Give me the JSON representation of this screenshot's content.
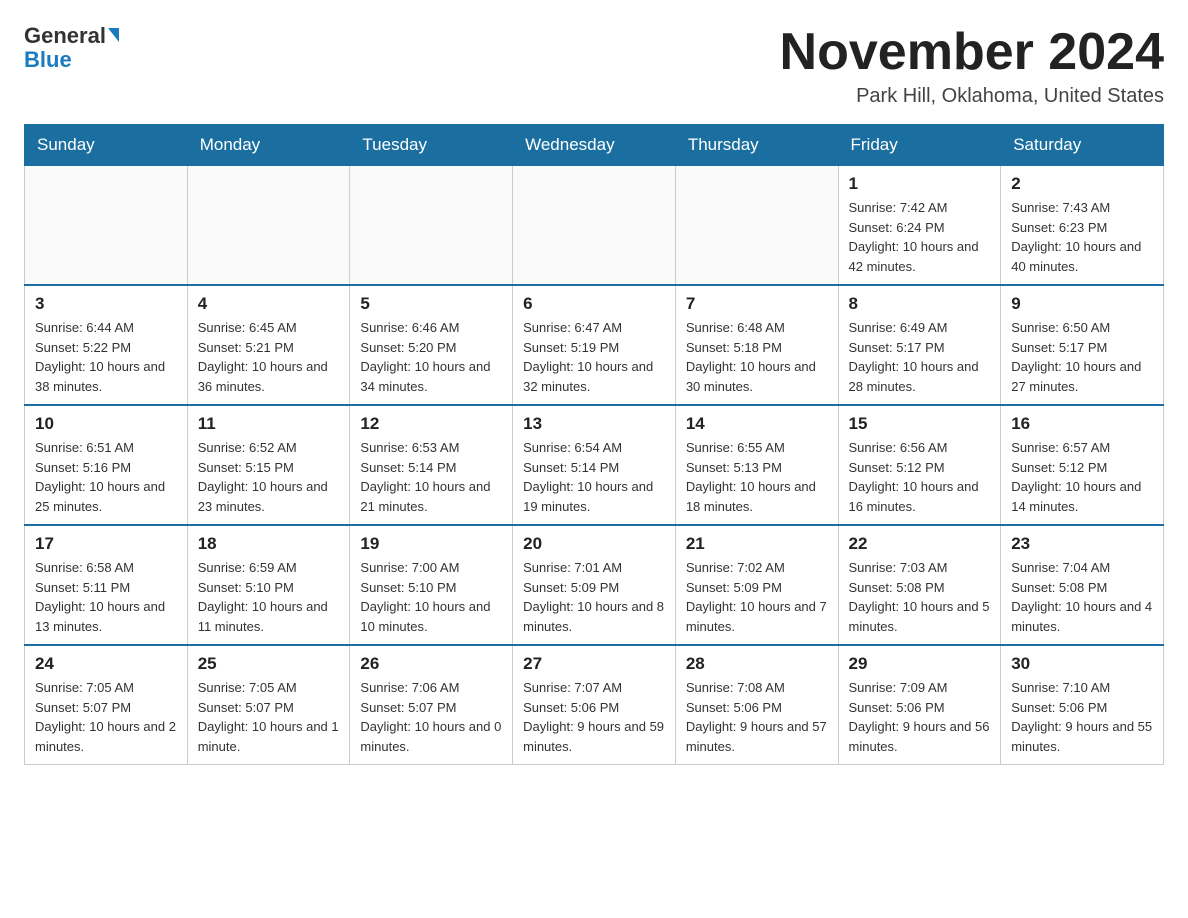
{
  "header": {
    "logo_line1": "General",
    "logo_line2": "Blue",
    "month_title": "November 2024",
    "location": "Park Hill, Oklahoma, United States"
  },
  "days_of_week": [
    "Sunday",
    "Monday",
    "Tuesday",
    "Wednesday",
    "Thursday",
    "Friday",
    "Saturday"
  ],
  "weeks": [
    [
      {
        "day": "",
        "info": ""
      },
      {
        "day": "",
        "info": ""
      },
      {
        "day": "",
        "info": ""
      },
      {
        "day": "",
        "info": ""
      },
      {
        "day": "",
        "info": ""
      },
      {
        "day": "1",
        "info": "Sunrise: 7:42 AM\nSunset: 6:24 PM\nDaylight: 10 hours and 42 minutes."
      },
      {
        "day": "2",
        "info": "Sunrise: 7:43 AM\nSunset: 6:23 PM\nDaylight: 10 hours and 40 minutes."
      }
    ],
    [
      {
        "day": "3",
        "info": "Sunrise: 6:44 AM\nSunset: 5:22 PM\nDaylight: 10 hours and 38 minutes."
      },
      {
        "day": "4",
        "info": "Sunrise: 6:45 AM\nSunset: 5:21 PM\nDaylight: 10 hours and 36 minutes."
      },
      {
        "day": "5",
        "info": "Sunrise: 6:46 AM\nSunset: 5:20 PM\nDaylight: 10 hours and 34 minutes."
      },
      {
        "day": "6",
        "info": "Sunrise: 6:47 AM\nSunset: 5:19 PM\nDaylight: 10 hours and 32 minutes."
      },
      {
        "day": "7",
        "info": "Sunrise: 6:48 AM\nSunset: 5:18 PM\nDaylight: 10 hours and 30 minutes."
      },
      {
        "day": "8",
        "info": "Sunrise: 6:49 AM\nSunset: 5:17 PM\nDaylight: 10 hours and 28 minutes."
      },
      {
        "day": "9",
        "info": "Sunrise: 6:50 AM\nSunset: 5:17 PM\nDaylight: 10 hours and 27 minutes."
      }
    ],
    [
      {
        "day": "10",
        "info": "Sunrise: 6:51 AM\nSunset: 5:16 PM\nDaylight: 10 hours and 25 minutes."
      },
      {
        "day": "11",
        "info": "Sunrise: 6:52 AM\nSunset: 5:15 PM\nDaylight: 10 hours and 23 minutes."
      },
      {
        "day": "12",
        "info": "Sunrise: 6:53 AM\nSunset: 5:14 PM\nDaylight: 10 hours and 21 minutes."
      },
      {
        "day": "13",
        "info": "Sunrise: 6:54 AM\nSunset: 5:14 PM\nDaylight: 10 hours and 19 minutes."
      },
      {
        "day": "14",
        "info": "Sunrise: 6:55 AM\nSunset: 5:13 PM\nDaylight: 10 hours and 18 minutes."
      },
      {
        "day": "15",
        "info": "Sunrise: 6:56 AM\nSunset: 5:12 PM\nDaylight: 10 hours and 16 minutes."
      },
      {
        "day": "16",
        "info": "Sunrise: 6:57 AM\nSunset: 5:12 PM\nDaylight: 10 hours and 14 minutes."
      }
    ],
    [
      {
        "day": "17",
        "info": "Sunrise: 6:58 AM\nSunset: 5:11 PM\nDaylight: 10 hours and 13 minutes."
      },
      {
        "day": "18",
        "info": "Sunrise: 6:59 AM\nSunset: 5:10 PM\nDaylight: 10 hours and 11 minutes."
      },
      {
        "day": "19",
        "info": "Sunrise: 7:00 AM\nSunset: 5:10 PM\nDaylight: 10 hours and 10 minutes."
      },
      {
        "day": "20",
        "info": "Sunrise: 7:01 AM\nSunset: 5:09 PM\nDaylight: 10 hours and 8 minutes."
      },
      {
        "day": "21",
        "info": "Sunrise: 7:02 AM\nSunset: 5:09 PM\nDaylight: 10 hours and 7 minutes."
      },
      {
        "day": "22",
        "info": "Sunrise: 7:03 AM\nSunset: 5:08 PM\nDaylight: 10 hours and 5 minutes."
      },
      {
        "day": "23",
        "info": "Sunrise: 7:04 AM\nSunset: 5:08 PM\nDaylight: 10 hours and 4 minutes."
      }
    ],
    [
      {
        "day": "24",
        "info": "Sunrise: 7:05 AM\nSunset: 5:07 PM\nDaylight: 10 hours and 2 minutes."
      },
      {
        "day": "25",
        "info": "Sunrise: 7:05 AM\nSunset: 5:07 PM\nDaylight: 10 hours and 1 minute."
      },
      {
        "day": "26",
        "info": "Sunrise: 7:06 AM\nSunset: 5:07 PM\nDaylight: 10 hours and 0 minutes."
      },
      {
        "day": "27",
        "info": "Sunrise: 7:07 AM\nSunset: 5:06 PM\nDaylight: 9 hours and 59 minutes."
      },
      {
        "day": "28",
        "info": "Sunrise: 7:08 AM\nSunset: 5:06 PM\nDaylight: 9 hours and 57 minutes."
      },
      {
        "day": "29",
        "info": "Sunrise: 7:09 AM\nSunset: 5:06 PM\nDaylight: 9 hours and 56 minutes."
      },
      {
        "day": "30",
        "info": "Sunrise: 7:10 AM\nSunset: 5:06 PM\nDaylight: 9 hours and 55 minutes."
      }
    ]
  ]
}
